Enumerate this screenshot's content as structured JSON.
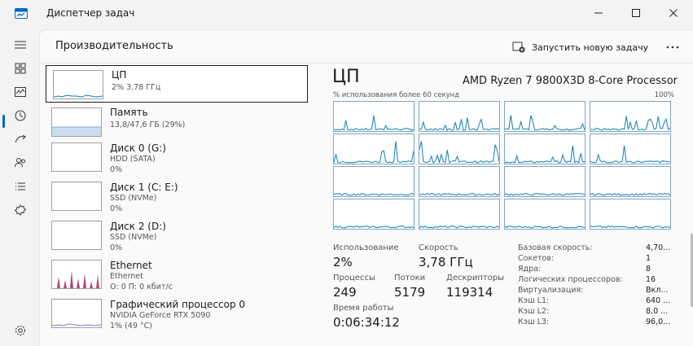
{
  "window": {
    "title": "Диспетчер задач"
  },
  "header": {
    "title": "Производительность",
    "run_task_label": "Запустить новую задачу"
  },
  "resources": [
    {
      "name": "ЦП",
      "line1": "2%  3,78 ГГц",
      "line2": ""
    },
    {
      "name": "Память",
      "line1": "13,8/47,6 ГБ (29%)",
      "line2": ""
    },
    {
      "name": "Диск 0 (G:)",
      "line1": "HDD (SATA)",
      "line2": "0%"
    },
    {
      "name": "Диск 1 (C: E:)",
      "line1": "SSD (NVMe)",
      "line2": "0%"
    },
    {
      "name": "Диск 2 (D:)",
      "line1": "SSD (NVMe)",
      "line2": "0%"
    },
    {
      "name": "Ethernet",
      "line1": "Ethernet",
      "line2": "О: 0 П: 0 кбит/с"
    },
    {
      "name": "Графический процессор 0",
      "line1": "NVIDIA GeForce RTX 5090",
      "line2": "1%  (49 °C)"
    }
  ],
  "detail": {
    "title": "ЦП",
    "cpu_name": "AMD Ryzen 7 9800X3D 8-Core Processor",
    "graph_label": "% использования более 60 секунд",
    "graph_max": "100%",
    "stats": {
      "usage_label": "Использование",
      "usage_value": "2%",
      "speed_label": "Скорость",
      "speed_value": "3,78 ГГц",
      "processes_label": "Процессы",
      "processes_value": "249",
      "threads_label": "Потоки",
      "threads_value": "5179",
      "handles_label": "Дескрипторы",
      "handles_value": "119314",
      "uptime_label": "Время работы",
      "uptime_value": "0:06:34:12"
    },
    "specs": [
      {
        "k": "Базовая скорость:",
        "v": "4,70..."
      },
      {
        "k": "Сокетов:",
        "v": "1"
      },
      {
        "k": "Ядра:",
        "v": "8"
      },
      {
        "k": "Логических процессоров:",
        "v": "16"
      },
      {
        "k": "Виртуализация:",
        "v": "Вкл..."
      },
      {
        "k": "Кэш L1:",
        "v": "640 ..."
      },
      {
        "k": "Кэш L2:",
        "v": "8,0 ..."
      },
      {
        "k": "Кэш L3:",
        "v": "96,0..."
      }
    ]
  },
  "colors": {
    "accent": "#0067c0",
    "cpu_line": "#117dbb",
    "memory_fill": "#c9dcf0",
    "ethernet": "#a7245e",
    "gpu": "#8e6bbf"
  }
}
